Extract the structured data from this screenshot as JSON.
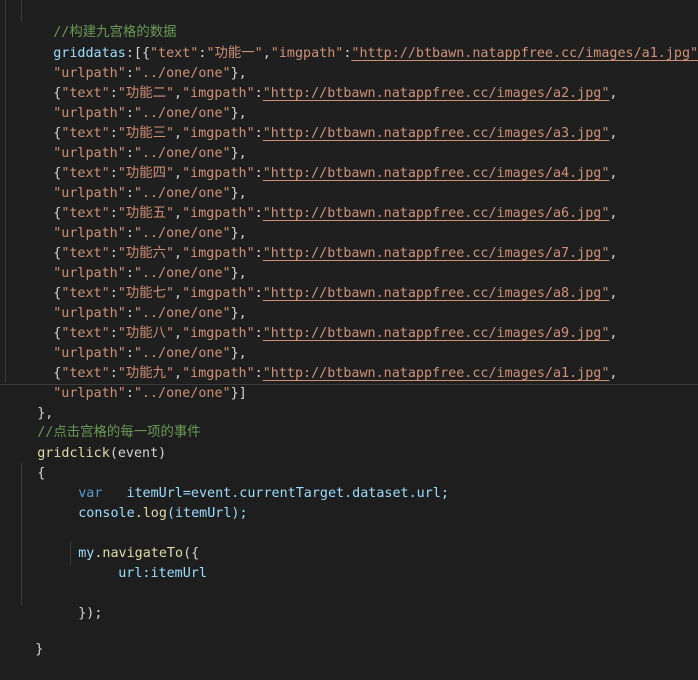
{
  "code": {
    "comment_grid": "//构建九宫格的数据",
    "griddatas_key": "griddatas",
    "colon": ":",
    "open_array": "[",
    "open_brace": "{",
    "close_brace_comma": "},",
    "close_array": "]",
    "text_key": "\"text\"",
    "imgpath_key": "\"imgpath\"",
    "urlpath_key": "\"urlpath\"",
    "urlpath_value": "\"../one/one\"",
    "comma": ",",
    "items": [
      {
        "text": "\"功能一\"",
        "img": "\"http://btbawn.natappfree.cc/images/a1.jpg\""
      },
      {
        "text": "\"功能二\"",
        "img": "\"http://btbawn.natappfree.cc/images/a2.jpg\""
      },
      {
        "text": "\"功能三\"",
        "img": "\"http://btbawn.natappfree.cc/images/a3.jpg\""
      },
      {
        "text": "\"功能四\"",
        "img": "\"http://btbawn.natappfree.cc/images/a4.jpg\""
      },
      {
        "text": "\"功能五\"",
        "img": "\"http://btbawn.natappfree.cc/images/a6.jpg\""
      },
      {
        "text": "\"功能六\"",
        "img": "\"http://btbawn.natappfree.cc/images/a7.jpg\""
      },
      {
        "text": "\"功能七\"",
        "img": "\"http://btbawn.natappfree.cc/images/a8.jpg\""
      },
      {
        "text": "\"功能八\"",
        "img": "\"http://btbawn.natappfree.cc/images/a9.jpg\""
      },
      {
        "text": "\"功能九\"",
        "img": "\"http://btbawn.natappfree.cc/images/a1.jpg\""
      }
    ],
    "comment_click": "//点击宫格的每一项的事件",
    "gridclick_name": "gridclick",
    "gridclick_param": "(event)",
    "var_kw": "var",
    "itemurl_assign": "itemUrl=event.currentTarget.dataset.url;",
    "console_obj": "console",
    "dot_log": ".log",
    "log_arg": "(itemUrl);",
    "my_obj": "my",
    "dot_nav": ".navigateTo",
    "nav_open": "({",
    "url_prop": "url:itemUrl",
    "nav_close": "});",
    "close_curly": "}"
  }
}
